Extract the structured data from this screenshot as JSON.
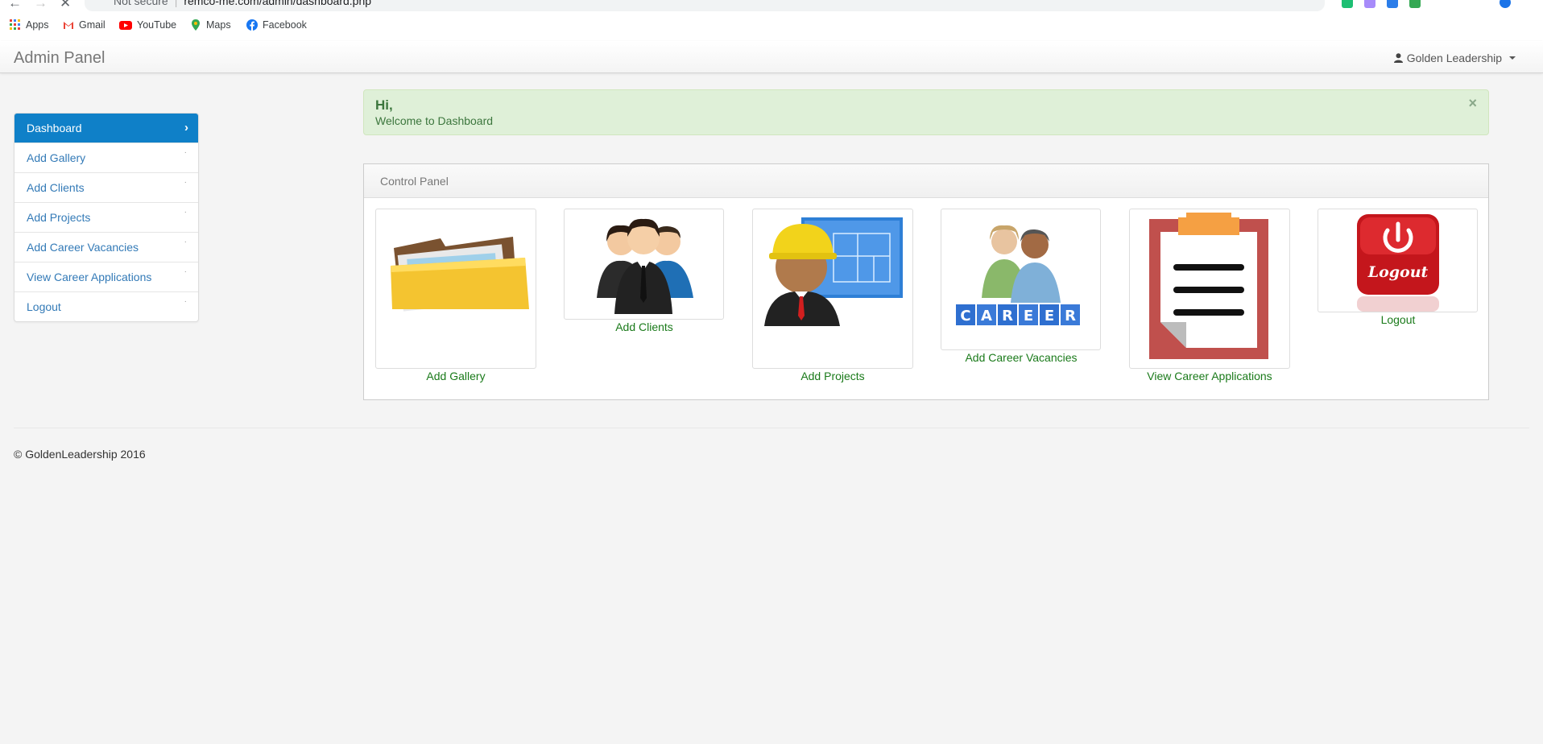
{
  "browser": {
    "security": "Not secure",
    "url": "remco-me.com/admin/dashboard.php",
    "bookmarks": [
      "Apps",
      "Gmail",
      "YouTube",
      "Maps",
      "Facebook"
    ]
  },
  "navbar": {
    "brand": "Admin Panel",
    "user": "Golden Leadership"
  },
  "sidebar": {
    "items": [
      {
        "label": "Dashboard",
        "active": true
      },
      {
        "label": "Add Gallery"
      },
      {
        "label": "Add Clients"
      },
      {
        "label": "Add Projects"
      },
      {
        "label": "Add Career Vacancies"
      },
      {
        "label": "View Career Applications"
      },
      {
        "label": "Logout"
      }
    ]
  },
  "alert": {
    "greeting": "Hi,",
    "message": "Welcome to Dashboard",
    "close": "×"
  },
  "panel": {
    "title": "Control Panel",
    "tiles": [
      {
        "label": "Add Gallery",
        "icon": "gallery-folder-icon"
      },
      {
        "label": "Add Clients",
        "icon": "clients-group-icon"
      },
      {
        "label": "Add Projects",
        "icon": "engineer-blueprint-icon"
      },
      {
        "label": "Add Career Vacancies",
        "icon": "career-people-icon"
      },
      {
        "label": "View Career Applications",
        "icon": "clipboard-icon"
      },
      {
        "label": "Logout",
        "icon": "logout-power-icon",
        "icon_text": "Logout"
      }
    ]
  },
  "footer": {
    "copyright": "© GoldenLeadership 2016"
  },
  "colors": {
    "accent": "#0f80c8",
    "link": "#337ab7",
    "tile_label": "#1a7a1a",
    "alert_bg": "#dff0d8"
  }
}
